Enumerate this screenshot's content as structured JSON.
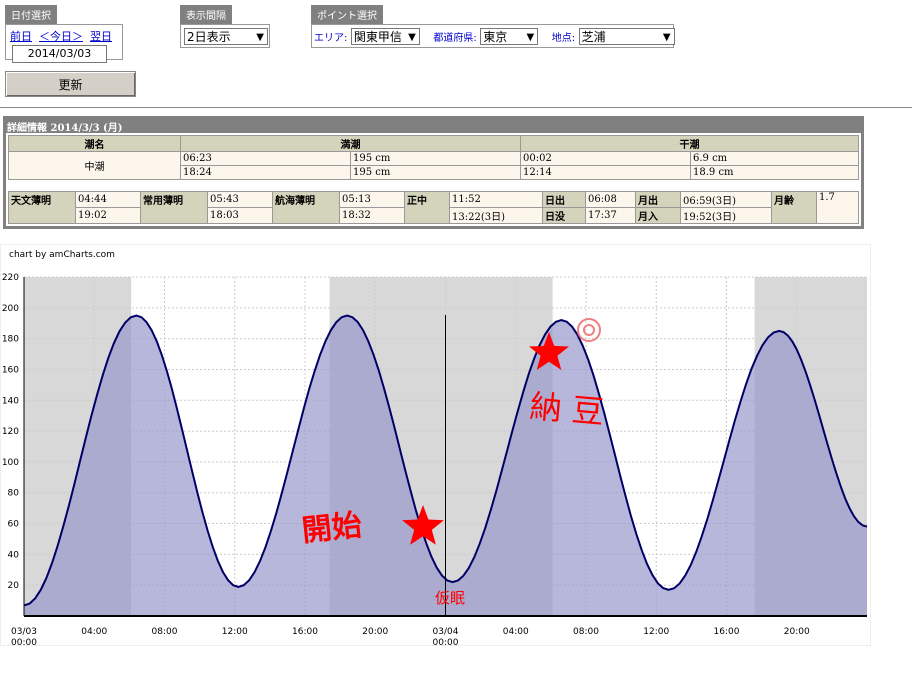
{
  "date_group": {
    "title": "日付選択",
    "prev": "前日",
    "today": "＜今日＞",
    "next": "翌日",
    "date": "2014/03/03"
  },
  "interval_group": {
    "title": "表示間隔",
    "selected": "2日表示"
  },
  "point_group": {
    "title": "ポイント選択",
    "area_label": "エリア:",
    "area": "関東甲信",
    "pref_label": "都道府県:",
    "pref": "東京",
    "place_label": "地点:",
    "place": "芝浦"
  },
  "update_button": "更新",
  "detail": {
    "title": "詳細情報  2014/3/3 (月)",
    "headers": {
      "tide_name": "潮名",
      "high": "満潮",
      "low": "干潮"
    },
    "tide_name": "中潮",
    "high": [
      {
        "time": "06:23",
        "level": "195 cm"
      },
      {
        "time": "18:24",
        "level": "195 cm"
      }
    ],
    "low": [
      {
        "time": "00:02",
        "level": "6.9 cm"
      },
      {
        "time": "12:14",
        "level": "18.9 cm"
      }
    ],
    "sun": {
      "astro_label": "天文薄明",
      "astro": [
        "04:44",
        "19:02"
      ],
      "civil_label": "常用薄明",
      "civil": [
        "05:43",
        "18:03"
      ],
      "nautical_label": "航海薄明",
      "nautical": [
        "05:13",
        "18:32"
      ],
      "noon_label": "正中",
      "noon": [
        "11:52",
        "13:22(3日)"
      ],
      "sunrise_label": "日出",
      "sunrise": "06:08",
      "sunset_label": "日没",
      "sunset": "17:37",
      "moonrise_label": "月出",
      "moonrise": "06:59(3日)",
      "moonset_label": "月入",
      "moonset": "19:52(3日)",
      "moonage_label": "月齢",
      "moonage": "1.7"
    }
  },
  "chart_credit": "chart by amCharts.com",
  "annotations": {
    "start": "開始",
    "natto": "納 豆",
    "nap": "仮眠"
  },
  "colors": {
    "line": "#000066",
    "fill": "#9999cc",
    "night": "#d8d8d8",
    "annotation": "#ff0000"
  },
  "chart_data": {
    "type": "area",
    "ylim": [
      0,
      220
    ],
    "yticks": [
      20,
      40,
      60,
      80,
      100,
      120,
      140,
      160,
      180,
      200,
      220
    ],
    "xlim_hours": [
      0,
      48
    ],
    "xticks": [
      {
        "h": 0,
        "label": "03/03",
        "label2": "00:00"
      },
      {
        "h": 4,
        "label": "04:00"
      },
      {
        "h": 8,
        "label": "08:00"
      },
      {
        "h": 12,
        "label": "12:00"
      },
      {
        "h": 16,
        "label": "16:00"
      },
      {
        "h": 20,
        "label": "20:00"
      },
      {
        "h": 24,
        "label": "03/04",
        "label2": "00:00"
      },
      {
        "h": 28,
        "label": "04:00"
      },
      {
        "h": 32,
        "label": "08:00"
      },
      {
        "h": 36,
        "label": "12:00"
      },
      {
        "h": 40,
        "label": "16:00"
      },
      {
        "h": 44,
        "label": "20:00"
      }
    ],
    "series": [
      {
        "hours": [
          0,
          6.4,
          12.2,
          18.4,
          24.4,
          30.6,
          36.7,
          43
        ],
        "values": [
          6.9,
          195,
          18.9,
          195,
          22,
          192,
          17,
          185
        ]
      }
    ],
    "last_value": [
      48,
      58
    ],
    "night_bands": [
      [
        0,
        6.1
      ],
      [
        17.4,
        30.1
      ],
      [
        41.6,
        48
      ]
    ],
    "now_hours": 24
  }
}
